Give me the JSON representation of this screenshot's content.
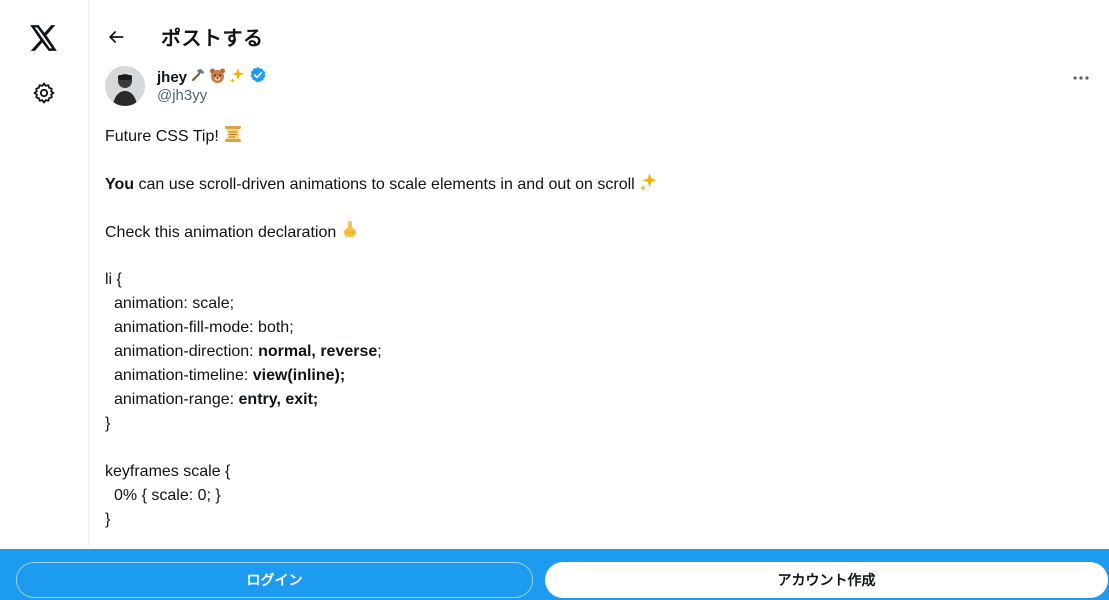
{
  "header": {
    "title": "ポストする"
  },
  "author": {
    "display_name": "jhey",
    "handle": "@jh3yy",
    "verified": true
  },
  "icons": {
    "logo": "x-logo-icon",
    "settings": "gear-icon",
    "back": "arrow-left-icon",
    "more": "more-icon",
    "verified": "verified-badge-icon"
  },
  "tweet": {
    "line1": "Future CSS Tip!",
    "line2_bold": "You",
    "line2_rest": " can use scroll-driven animations to scale elements in and out on scroll",
    "line3": "Check this animation declaration",
    "code": {
      "open": "li {",
      "l1": "animation: scale;",
      "l2": "animation-fill-mode: both;",
      "l3_key": "animation-direction: ",
      "l3_val": "normal, reverse",
      "l3_end": ";",
      "l4_key": "animation-timeline: ",
      "l4_val": "view(inline);",
      "l5_key": "animation-range: ",
      "l5_val": "entry, exit;",
      "close": "}",
      "kf_open": "keyframes scale {",
      "kf_line": "0% { scale: 0; }",
      "kf_close": "}"
    }
  },
  "bottom": {
    "login_label": "ログイン",
    "signup_label": "アカウント作成"
  },
  "colors": {
    "accent": "#1d9bf0",
    "text": "#0f1419",
    "muted": "#536471"
  }
}
